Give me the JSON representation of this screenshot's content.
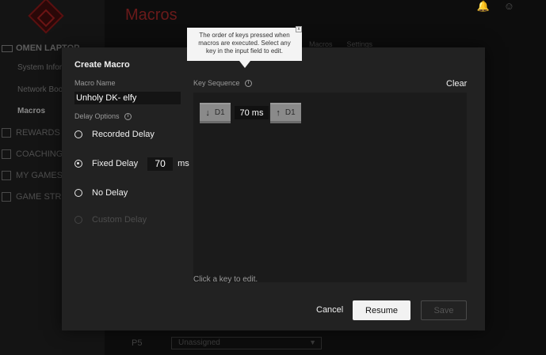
{
  "app": {
    "page_title": "Macros",
    "sidebar": {
      "section_label": "OMEN LAPTOP",
      "sub_items": [
        {
          "label": "System Information",
          "active": false
        },
        {
          "label": "Network Booster",
          "active": false
        },
        {
          "label": "Macros",
          "active": true
        }
      ],
      "items": [
        {
          "label": "REWARDS",
          "icon": "trophy-icon"
        },
        {
          "label": "COACHING",
          "icon": "coaching-icon"
        },
        {
          "label": "MY GAMES",
          "icon": "games-library-icon"
        },
        {
          "label": "GAME STREAMING",
          "icon": "streaming-icon"
        }
      ]
    },
    "top_icons": [
      "bell-icon",
      "user-icon"
    ],
    "background_tabs": [
      "Macros",
      "Settings"
    ],
    "background_row": {
      "label": "P5",
      "select_value": "Unassigned"
    }
  },
  "modal": {
    "title": "Create Macro",
    "macro_name_label": "Macro Name",
    "macro_name_value": "Unholy DK- elfy",
    "delay_options_label": "Delay Options",
    "delay_options": [
      {
        "label": "Recorded Delay",
        "checked": false,
        "disabled": false
      },
      {
        "label": "Fixed Delay",
        "checked": true,
        "disabled": false
      },
      {
        "label": "No Delay",
        "checked": false,
        "disabled": false
      },
      {
        "label": "Custom Delay",
        "checked": false,
        "disabled": true
      }
    ],
    "fixed_delay_value": "70",
    "fixed_delay_unit": "ms",
    "key_sequence_label": "Key Sequence",
    "clear_label": "Clear",
    "sequence": [
      {
        "arrow": "↓",
        "key": "D1",
        "action": "key-down"
      },
      {
        "delay": "70 ms"
      },
      {
        "arrow": "↑",
        "key": "D1",
        "action": "key-up"
      }
    ],
    "sequence_hint": "Click a key to edit.",
    "cancel_label": "Cancel",
    "resume_label": "Resume",
    "save_label": "Save"
  },
  "tooltip": {
    "text": "The order of keys pressed when macros are executed. Select any key in the input field to edit.",
    "close_symbol": "x"
  },
  "colors": {
    "modal_bg": "#222222",
    "sequence_bg": "#1b1b1b",
    "key_chip": "#8a8a8a",
    "accent_red": "#6a1a1a",
    "resume_button": "#f2f2f2"
  }
}
